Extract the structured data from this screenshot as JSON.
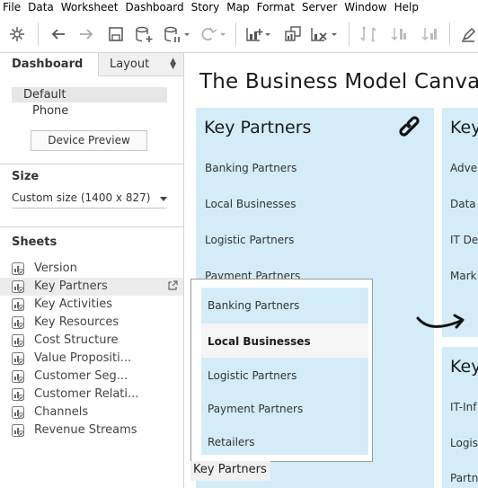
{
  "menu": [
    "File",
    "Data",
    "Worksheet",
    "Dashboard",
    "Story",
    "Map",
    "Format",
    "Server",
    "Window",
    "Help"
  ],
  "toolbar": {
    "icons": [
      "tableau-logo-icon",
      "undo-icon",
      "redo-icon",
      "save-icon",
      "new-data-source-icon",
      "pause-updates-icon",
      "refresh-icon",
      "new-worksheet-icon",
      "duplicate-icon",
      "clear-sheet-icon",
      "swap-icon",
      "sort-ascending-icon",
      "sort-descending-icon",
      "highlight-icon"
    ]
  },
  "left_panel": {
    "tab_dashboard": "Dashboard",
    "tab_layout": "Layout",
    "devices": {
      "default": "Default",
      "phone": "Phone"
    },
    "device_preview_button": "Device Preview",
    "size_title": "Size",
    "size_value": "Custom size (1400 x 827)",
    "sheets_title": "Sheets",
    "sheets": [
      {
        "label": "Version"
      },
      {
        "label": "Key Partners",
        "active": true
      },
      {
        "label": "Key Activities"
      },
      {
        "label": "Key Resources"
      },
      {
        "label": "Cost Structure"
      },
      {
        "label": "Value Propositi..."
      },
      {
        "label": "Customer Seg..."
      },
      {
        "label": "Customer Relati..."
      },
      {
        "label": "Channels"
      },
      {
        "label": "Revenue Streams"
      }
    ]
  },
  "canvas": {
    "title": "The Business Model Canvas",
    "key_partners": {
      "heading": "Key Partners",
      "items": [
        "Banking Partners",
        "Local Businesses",
        "Logistic Partners",
        "Payment Partners"
      ]
    },
    "key_activities": {
      "heading": "Key",
      "items": [
        "Adve",
        "Data",
        "IT De",
        "Mark"
      ]
    },
    "key_resources": {
      "heading": "Key",
      "items": [
        "IT-Inf",
        "Logis",
        "Partn"
      ]
    }
  },
  "tooltip": {
    "items": [
      "Banking Partners",
      "Local Businesses",
      "Logistic Partners",
      "Payment Partners",
      "Retailers"
    ],
    "highlighted_index": 1,
    "caption": "Key Partners"
  },
  "colors": {
    "card_bg": "#d4ecf7",
    "panel_border": "#d4d4d4"
  }
}
